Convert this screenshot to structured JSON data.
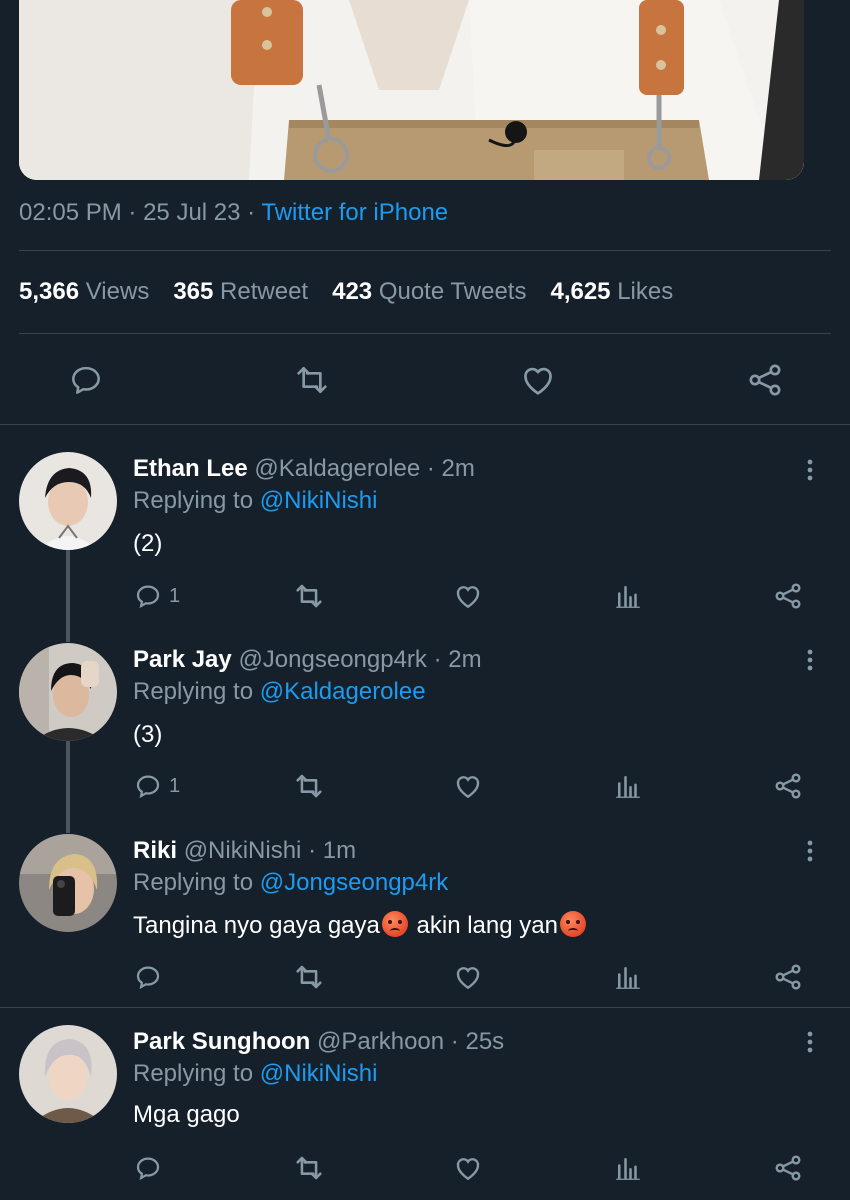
{
  "tweet": {
    "time": "02:05 PM",
    "date": "25 Jul 23",
    "source": "Twitter for iPhone",
    "stats": [
      {
        "num": "5,366",
        "label": "Views"
      },
      {
        "num": "365",
        "label": "Retweet"
      },
      {
        "num": "423",
        "label": "Quote Tweets"
      },
      {
        "num": "4,625",
        "label": "Likes"
      }
    ]
  },
  "replies": [
    {
      "name": "Ethan Lee",
      "handle": "@Kaldagerolee",
      "age": "2m",
      "replying_prefix": "Replying to",
      "replying_to": "@NikiNishi",
      "text": "(2)",
      "reply_count": "1"
    },
    {
      "name": "Park Jay",
      "handle": "@Jongseongp4rk",
      "age": "2m",
      "replying_prefix": "Replying to",
      "replying_to": "@Kaldagerolee",
      "text": "(3)",
      "reply_count": "1"
    },
    {
      "name": "Riki",
      "handle": "@NikiNishi",
      "age": "1m",
      "replying_prefix": "Replying to",
      "replying_to": "@Jongseongp4rk",
      "text_part1": "Tangina nyo gaya gaya",
      "text_part2": " akin lang yan",
      "reply_count": ""
    },
    {
      "name": "Park Sunghoon",
      "handle": "@Parkhoon",
      "age": "25s",
      "replying_prefix": "Replying to",
      "replying_to": "@NikiNishi",
      "text": "Mga gago",
      "reply_count": ""
    }
  ],
  "colors": {
    "background": "#15202b",
    "accent": "#1d9bf0",
    "muted": "#8899a6",
    "divider": "#38444d"
  },
  "icons": [
    "reply-icon",
    "retweet-icon",
    "like-icon",
    "share-icon",
    "views-icon",
    "more-icon",
    "angry-emoji"
  ]
}
